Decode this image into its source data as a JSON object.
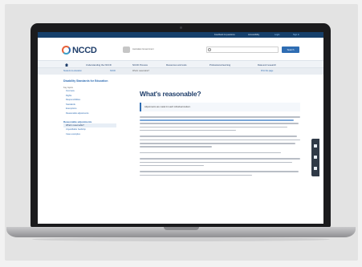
{
  "site": {
    "logo_text": "NCCD",
    "govt_label": "Australian Government",
    "search_button": "Search"
  },
  "utility_links": [
    "Feedback & questions",
    "Accessibility",
    "Login",
    "Sign in"
  ],
  "nav": {
    "items": [
      "Understanding the NCCD",
      "NCCD Process",
      "Resources and tools",
      "Professional learning",
      "Data and research"
    ]
  },
  "breadcrumb": [
    "Students & education",
    "NCCD",
    "What's reasonable?"
  ],
  "print_label": "Print this page",
  "sidebar": {
    "title": "Disability Standards for Education",
    "sub_heading": "Key topics",
    "items": [
      "Overview",
      "Rights",
      "Responsibilities",
      "Standards",
      "Exemptions",
      "Reasonable adjustments"
    ],
    "section_heading": "Reasonable adjustments",
    "section_items": [
      "What's reasonable?",
      "Unjustifiable hardship",
      "Case examples"
    ]
  },
  "main": {
    "title": "What's reasonable?",
    "callout": "Adjustments are made for each individual student."
  },
  "side_tools": [
    "share-icon",
    "print-icon",
    "bookmark-icon"
  ]
}
